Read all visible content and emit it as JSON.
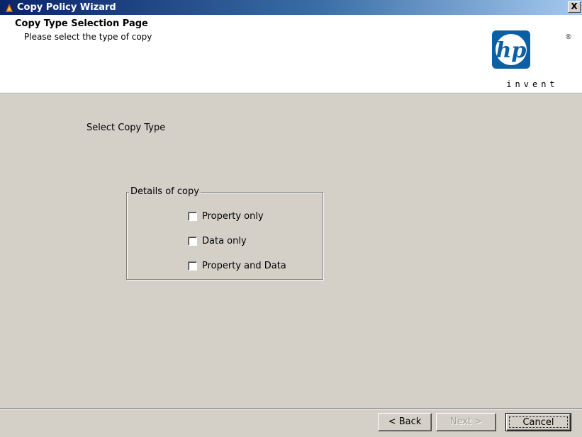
{
  "window": {
    "title": "Copy Policy Wizard",
    "close_label": "X"
  },
  "header": {
    "page_title": "Copy Type Selection Page",
    "page_subtitle": "Please select the type of copy",
    "logo_text": "hp",
    "logo_tagline": "invent",
    "logo_registered": "®"
  },
  "main": {
    "select_label": "Select Copy Type",
    "group_title": "Details of copy",
    "options": [
      {
        "label": "Property only",
        "checked": false
      },
      {
        "label": "Data only",
        "checked": false
      },
      {
        "label": "Property and Data",
        "checked": false
      }
    ]
  },
  "footer": {
    "back_label": "< Back",
    "next_label": "Next >",
    "cancel_label": "Cancel",
    "next_enabled": false
  },
  "colors": {
    "title_bar": "#0a246a",
    "dialog_bg": "#d4d0c8",
    "hp_blue": "#0b5fa5"
  }
}
